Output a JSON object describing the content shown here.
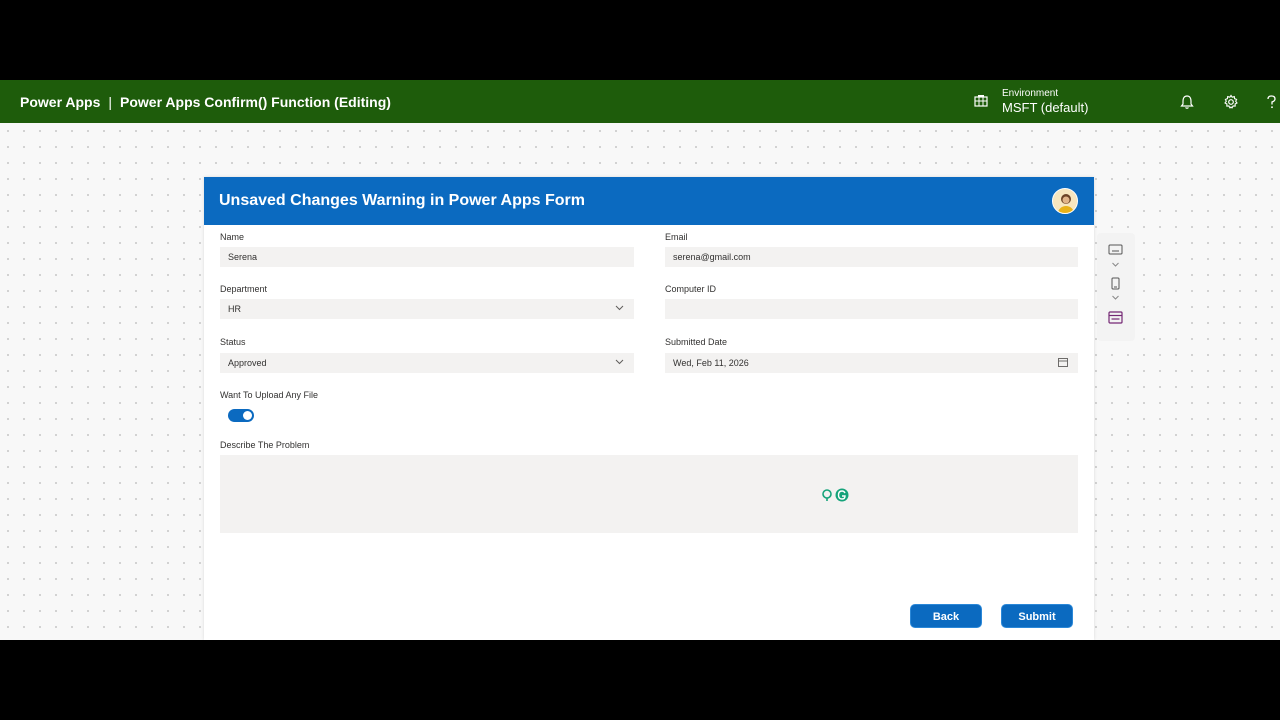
{
  "header": {
    "app_name": "Power Apps",
    "separator": "|",
    "app_title": "Power Apps Confirm() Function (Editing)",
    "environment_label": "Environment",
    "environment_value": "MSFT (default)",
    "icons": [
      "environment-icon",
      "bell-icon",
      "gear-icon",
      "help-icon"
    ]
  },
  "form": {
    "title": "Unsaved Changes Warning in Power Apps Form",
    "fields": {
      "name": {
        "label": "Name",
        "value": "Serena"
      },
      "email": {
        "label": "Email",
        "value": "serena@gmail.com"
      },
      "department": {
        "label": "Department",
        "value": "HR"
      },
      "computer_id": {
        "label": "Computer ID",
        "value": ""
      },
      "status": {
        "label": "Status",
        "value": "Approved"
      },
      "submitted_date": {
        "label": "Submitted Date",
        "value": "Wed, Feb 11, 2026"
      },
      "upload": {
        "label": "Want To Upload Any File",
        "value": "on"
      },
      "problem": {
        "label": "Describe The Problem",
        "value": ""
      }
    },
    "buttons": {
      "back": "Back",
      "submit": "Submit"
    }
  },
  "colors": {
    "header_bg": "#1e5c0b",
    "form_header_bg": "#0b6ac0",
    "button_bg": "#0b6ac0",
    "field_bg": "#f3f2f1"
  }
}
